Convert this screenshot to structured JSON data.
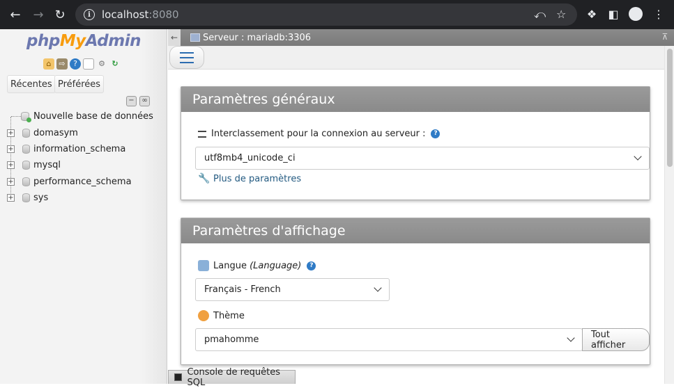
{
  "browser": {
    "url_host": "localhost",
    "url_port": ":8080"
  },
  "sidebar": {
    "logo_php": "php",
    "logo_my": "My",
    "logo_admin": "Admin",
    "tabs": [
      {
        "label": "Récentes"
      },
      {
        "label": "Préférées"
      }
    ],
    "new_db_label": "Nouvelle base de données",
    "databases": [
      {
        "name": "domasym"
      },
      {
        "name": "information_schema"
      },
      {
        "name": "mysql"
      },
      {
        "name": "performance_schema"
      },
      {
        "name": "sys"
      }
    ]
  },
  "server_bar": {
    "label": "Serveur : mariadb:3306"
  },
  "general": {
    "title": "Paramètres généraux",
    "collation_label": "Interclassement pour la connexion au serveur :",
    "collation_value": "utf8mb4_unicode_ci",
    "more_settings": "Plus de paramètres"
  },
  "display": {
    "title": "Paramètres d'affichage",
    "language_label": "Langue",
    "language_label_en": "(Language)",
    "language_value": "Français - French",
    "theme_label": "Thème",
    "theme_value": "pmahomme",
    "show_all_button": "Tout afficher"
  },
  "console": {
    "label": "Console de requêtes SQL"
  },
  "colors": {
    "logo_blue": "#6c78af",
    "logo_orange": "#f89c0e",
    "group_header": "#8a8a8a",
    "link": "#235a81"
  }
}
